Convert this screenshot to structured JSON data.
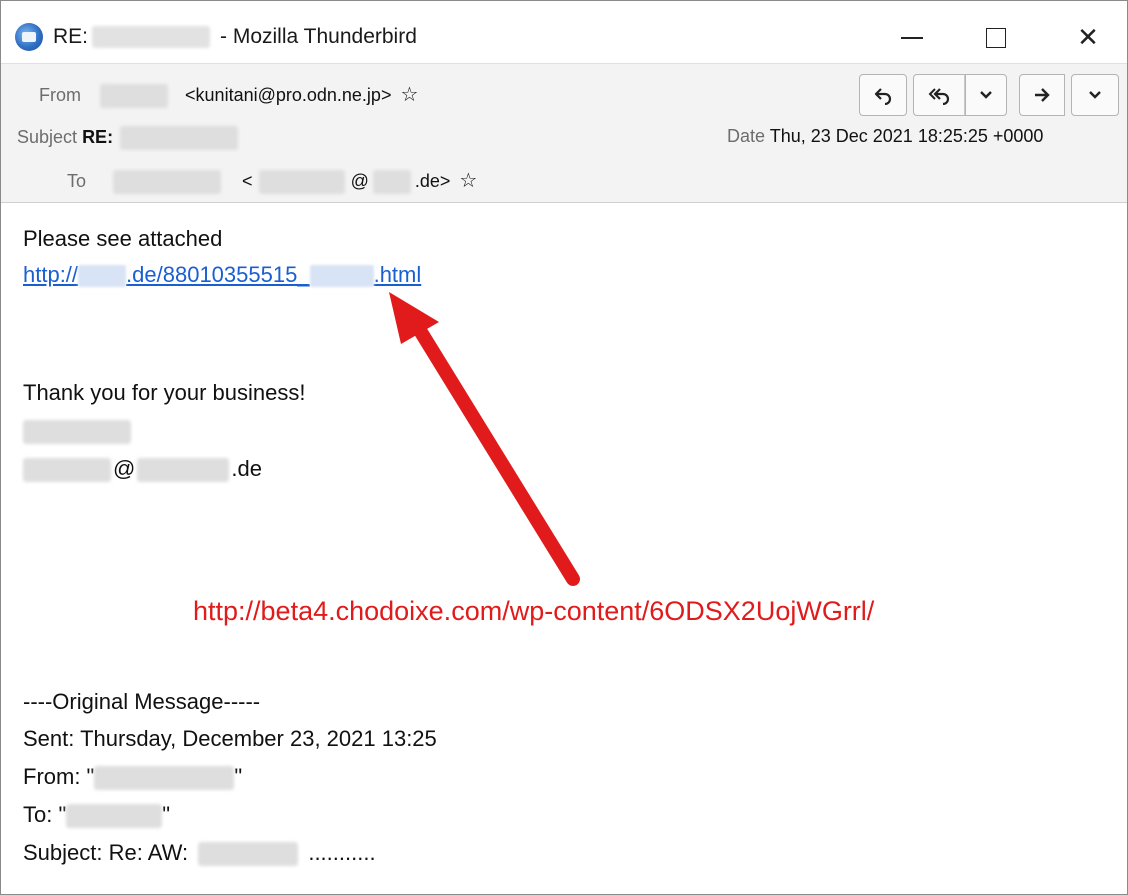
{
  "window": {
    "title_prefix": "RE:",
    "title_suffix": "- Mozilla Thunderbird",
    "minimize_glyph": "—",
    "maximize_glyph": "☐",
    "close_glyph": "✕"
  },
  "header": {
    "from_label": "From",
    "from_email": "<kunitani@pro.odn.ne.jp>",
    "subject_label": "Subject",
    "subject_value": "RE:",
    "to_label": "To",
    "to_open": "<",
    "to_at": "@",
    "to_domain": ".de>",
    "date_label": "Date",
    "date_value": "Thu, 23 Dec 2021 18:25:25 +0000",
    "star_glyph": "☆",
    "buttons": {
      "reply": "⮌",
      "reply_all": "⮌",
      "dropdown": "⌄",
      "forward": "➙",
      "more": "⌄"
    }
  },
  "body": {
    "line1": "Please see attached",
    "link_prefix": "http://",
    "link_mid": ".de/88010355515_",
    "link_suffix": ".html",
    "thanks": "Thank you for your business!",
    "sig_at": "@",
    "sig_domain": ".de",
    "annotation_url": "http://beta4.chodoixe.com/wp-content/6ODSX2UojWGrrl/",
    "orig_header": "----Original Message-----",
    "sent": "Sent: Thursday, December 23, 2021 13:25",
    "orig_from_prefix": "From: \"",
    "orig_from_suffix": "\"",
    "orig_to_prefix": "To: \"",
    "orig_to_suffix": "\"",
    "orig_subject_prefix": "Subject: Re: AW:",
    "orig_subject_suffix": "..........."
  },
  "colors": {
    "link": "#1a5fd1",
    "annotation": "#e11b1b",
    "header_bg": "#f3f3f3"
  }
}
